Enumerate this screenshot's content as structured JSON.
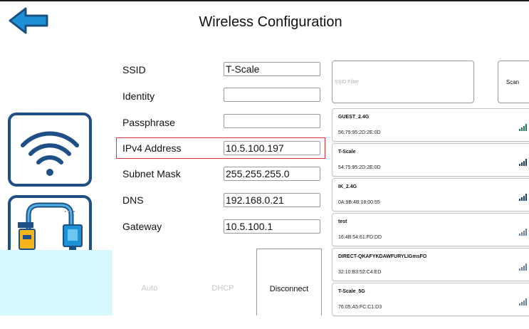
{
  "header": {
    "title": "Wireless Configuration"
  },
  "form": {
    "ssid_label": "SSID",
    "ssid_value": "T-Scale",
    "identity_label": "Identity",
    "identity_value": "",
    "passphrase_label": "Passphrase",
    "passphrase_value": "",
    "ipv4_label": "IPv4 Address",
    "ipv4_value": "10.5.100.197",
    "subnet_label": "Subnet Mask",
    "subnet_value": "255.255.255.0",
    "dns_label": "DNS",
    "dns_value": "192.168.0.21",
    "gateway_label": "Gateway",
    "gateway_value": "10.5.100.1"
  },
  "buttons": {
    "auto": "Auto",
    "dhcp": "DHCP",
    "disconnect": "Disconnect",
    "scan": "Scan"
  },
  "filter": {
    "placeholder": "SSID Filter"
  },
  "networks": [
    {
      "name": "GUEST_2.4G",
      "mac": "56:75:95:2D:2E:0D",
      "signal_color": "#1f7a5a"
    },
    {
      "name": "T-Scale",
      "mac": "54:75:95:2D:2E:0D",
      "signal_color": "#1e3f66"
    },
    {
      "name": "IK_2.4G",
      "mac": "0A:9B:4B:18:00:55",
      "signal_color": "#1e3f66"
    },
    {
      "name": "test",
      "mac": "16:4B:54:61:FD:DD",
      "signal_color": "#6b7f99"
    },
    {
      "name": "DIRECT-QKAFYKDAWFURYLIGmsFO",
      "mac": "32:10:B3:52:C4:ED",
      "signal_color": "#6b7f99"
    },
    {
      "name": "T-Scale_5G",
      "mac": "76:05:A5:FC:C1:D3",
      "signal_color": "#6b7f99"
    }
  ],
  "colors": {
    "accent_blue": "#1e90d6",
    "icon_dark": "#1e4f86",
    "highlight_red": "#dd3333",
    "panel_cyan": "#d6f7fb"
  },
  "icons": {
    "back": "back-arrow-icon",
    "wifi": "wifi-icon",
    "ethernet": "ethernet-icon",
    "signal": "signal-strength-icon"
  }
}
